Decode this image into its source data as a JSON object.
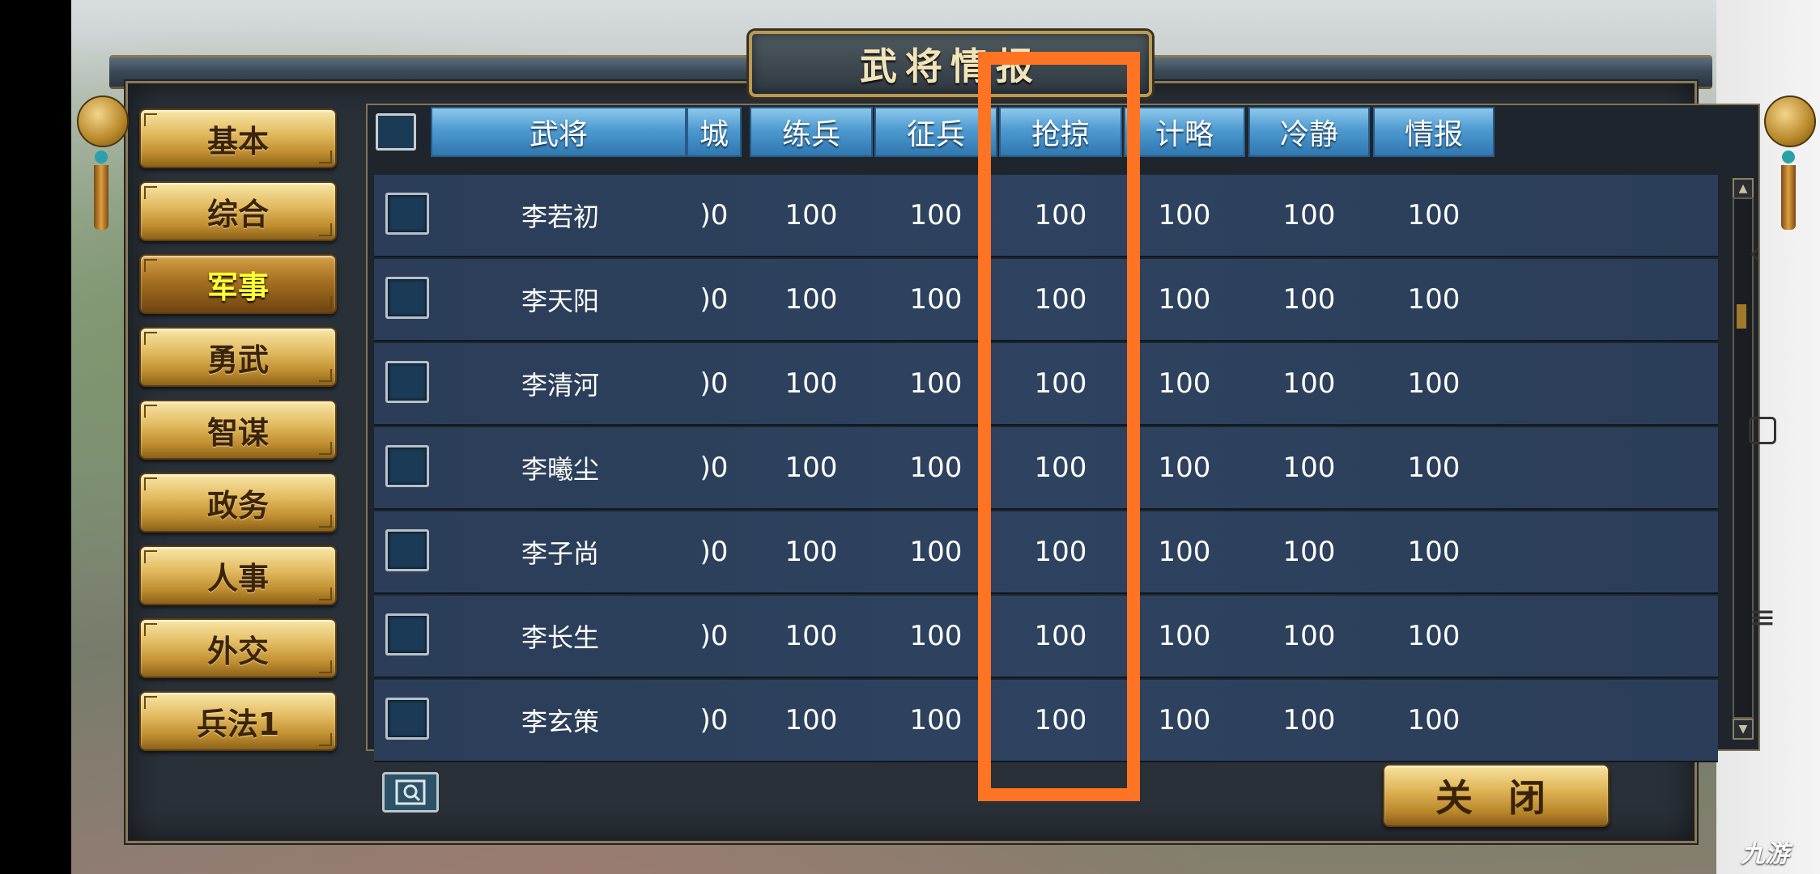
{
  "window": {
    "title": "武将情报"
  },
  "sidebar": {
    "items": [
      {
        "label": "基本"
      },
      {
        "label": "综合"
      },
      {
        "label": "军事"
      },
      {
        "label": "勇武"
      },
      {
        "label": "智谋"
      },
      {
        "label": "政务"
      },
      {
        "label": "人事"
      },
      {
        "label": "外交"
      },
      {
        "label": "兵法1"
      }
    ],
    "active_index": 2
  },
  "table": {
    "columns": [
      "武将",
      "城",
      "练兵",
      "征兵",
      "抢掠",
      "计略",
      "冷静",
      "情报"
    ],
    "rows": [
      {
        "name": "李若初",
        "values": [
          ")0",
          "100",
          "100",
          "100",
          "100",
          "100",
          "100"
        ]
      },
      {
        "name": "李天阳",
        "values": [
          ")0",
          "100",
          "100",
          "100",
          "100",
          "100",
          "100"
        ]
      },
      {
        "name": "李清河",
        "values": [
          ")0",
          "100",
          "100",
          "100",
          "100",
          "100",
          "100"
        ]
      },
      {
        "name": "李曦尘",
        "values": [
          ")0",
          "100",
          "100",
          "100",
          "100",
          "100",
          "100"
        ]
      },
      {
        "name": "李子尚",
        "values": [
          ")0",
          "100",
          "100",
          "100",
          "100",
          "100",
          "100"
        ]
      },
      {
        "name": "李长生",
        "values": [
          ")0",
          "100",
          "100",
          "100",
          "100",
          "100",
          "100"
        ]
      },
      {
        "name": "李玄策",
        "values": [
          ")0",
          "100",
          "100",
          "100",
          "100",
          "100",
          "100"
        ]
      }
    ]
  },
  "footer": {
    "close_label": "关 闭"
  },
  "colors": {
    "highlight": "#ff7423",
    "active_text": "#ffff33",
    "header_blue": "#4e9ad0"
  },
  "watermark": "九游"
}
